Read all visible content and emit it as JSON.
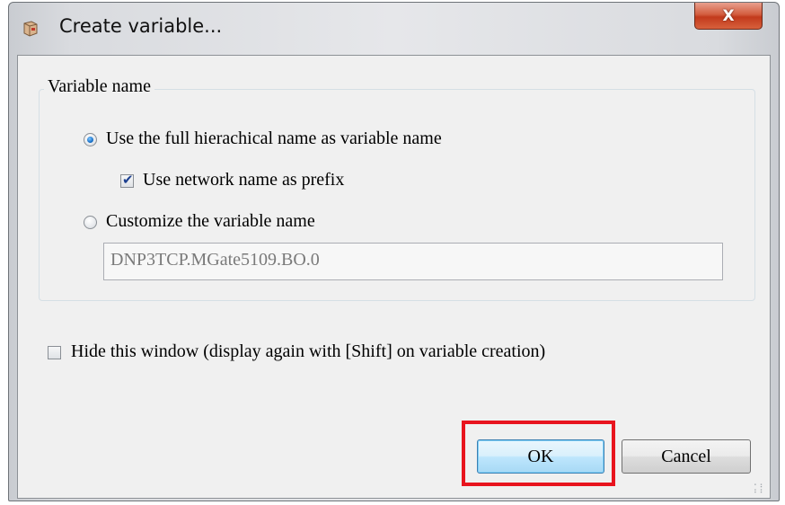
{
  "dialog": {
    "title": "Create variable...",
    "close_label": "X"
  },
  "variable_group": {
    "legend": "Variable name",
    "option_full_name": {
      "label": "Use the full hierachical name as variable name",
      "checked": true
    },
    "network_prefix": {
      "label": "Use network name as prefix",
      "checked": true
    },
    "option_customize": {
      "label": "Customize the variable name",
      "checked": false
    },
    "custom_name": {
      "value": "DNP3TCP.MGate5109.BO.0",
      "enabled": false
    }
  },
  "hide_window": {
    "label": "Hide this window (display again with [Shift] on variable creation)",
    "checked": false
  },
  "buttons": {
    "ok_label": "OK",
    "cancel_label": "Cancel"
  },
  "colors": {
    "highlight": "#e8141e",
    "close_button": "#c23a1c",
    "radio_selected": "#1a72c9",
    "checkmark": "#1c3f8f"
  },
  "icons": {
    "app": "app-icon",
    "close": "close-icon",
    "check": "checkmark-icon",
    "grip": "resize-grip-icon"
  }
}
